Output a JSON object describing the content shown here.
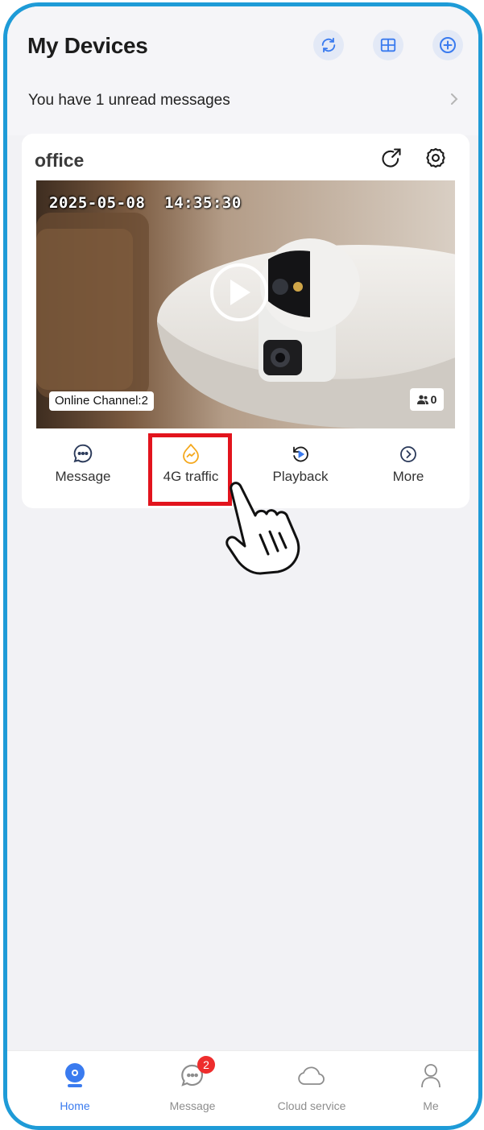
{
  "header": {
    "title": "My Devices",
    "buttons": {
      "refresh": "refresh-icon",
      "grid": "grid-view-icon",
      "add": "add-device-icon"
    }
  },
  "notice": {
    "text": "You have 1 unread messages",
    "icon": "chevron-right-icon"
  },
  "device": {
    "name": "office",
    "share_icon": "share-icon",
    "settings_icon": "gear-icon",
    "preview": {
      "timestamp": "2025-05-08  14:35:30",
      "channel_label": "Online Channel:2",
      "viewer_count": "0"
    },
    "actions": [
      {
        "label": "Message",
        "icon": "message-icon"
      },
      {
        "label": "4G traffic",
        "icon": "traffic-icon"
      },
      {
        "label": "Playback",
        "icon": "playback-icon"
      },
      {
        "label": "More",
        "icon": "more-icon"
      }
    ]
  },
  "tabbar": {
    "tabs": [
      {
        "label": "Home",
        "icon": "home-camera-icon",
        "active": true
      },
      {
        "label": "Message",
        "icon": "chat-icon",
        "badge": "2"
      },
      {
        "label": "Cloud service",
        "icon": "cloud-icon"
      },
      {
        "label": "Me",
        "icon": "person-icon"
      }
    ]
  },
  "colors": {
    "accent": "#3a7bef",
    "highlight": "#e2141d",
    "frame": "#1e9bd7",
    "traffic": "#f4a81d"
  }
}
